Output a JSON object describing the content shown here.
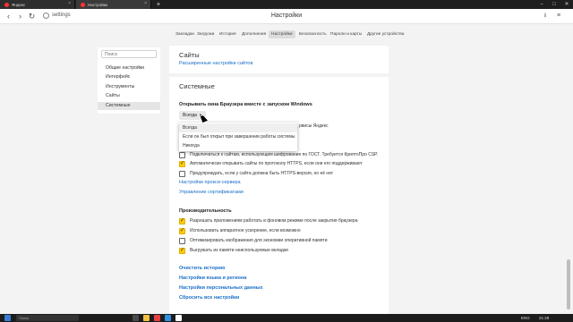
{
  "browser": {
    "tabs": [
      {
        "label": "Яндекс",
        "color": "#ff3333"
      },
      {
        "label": "Настройки",
        "color": "#ff3333"
      },
      {
        "label": "",
        "color": "#ffcc00"
      }
    ],
    "new_tab": "+",
    "controls": {
      "minimize": "–",
      "maximize": "□",
      "close": "✕"
    }
  },
  "addressbar": {
    "back": "‹",
    "forward": "›",
    "reload": "↻",
    "url": "settings",
    "page_title": "Настройки",
    "download": "⭳",
    "menu": "≡"
  },
  "settings_nav": {
    "items": [
      "Закладки",
      "Загрузки",
      "История",
      "Дополнения",
      "Настройки",
      "Безопасность",
      "Пароли и карты",
      "Другие устройства"
    ],
    "active_index": 4
  },
  "sidebar": {
    "search_placeholder": "Поиск",
    "items": [
      "Общие настройки",
      "Интерфейс",
      "Инструменты",
      "Сайты",
      "Системные"
    ],
    "active_index": 4
  },
  "main": {
    "sites": {
      "title": "Сайты",
      "advanced_link": "Расширенные настройки сайтов"
    },
    "system": {
      "title": "Системные",
      "startup_label": "Открывать окна Браузера вместе с запуском Windows",
      "startup_value": "Всегда",
      "hidden_row_tail": "рвисы Яндекс",
      "network_rows": [
        {
          "label": "Подключаться к сайтам, использующим шифрование по ГОСТ. Требуется КриптоПро CSP.",
          "checked": false
        },
        {
          "label": "Автоматически открывать сайты по протоколу HTTPS, если они его поддерживают",
          "checked": true
        },
        {
          "label": "Предупреждать, если у сайта должна быть HTTPS-версия, но её нет",
          "checked": false
        }
      ],
      "proxy_link": "Настройки прокси-сервера",
      "certs_link": "Управление сертификатами",
      "performance_title": "Производительность",
      "performance_rows": [
        {
          "label": "Разрешать приложениям работать в фоновом режиме после закрытия браузера",
          "checked": true
        },
        {
          "label": "Использовать аппаратное ускорение, если возможно",
          "checked": true
        },
        {
          "label": "Оптимизировать изображения для экономии оперативной памяти",
          "checked": false
        },
        {
          "label": "Выгружать из памяти неиспользуемые вкладки",
          "checked": true
        }
      ],
      "bottom_links": [
        "Очистить историю",
        "Настройки языка и региона",
        "Настройки персональных данных",
        "Сбросить все настройки"
      ]
    }
  },
  "dropdown": {
    "options": [
      "Всегда",
      "Если он был открыт при завершении работы системы",
      "Никогда"
    ],
    "selected_index": 0
  },
  "taskbar": {
    "search_placeholder": "Поиск",
    "lang": "ENG",
    "time": "21:28"
  },
  "colors": {
    "accent_link": "#1a6fc9",
    "checkbox_checked": "#ffcc00"
  }
}
